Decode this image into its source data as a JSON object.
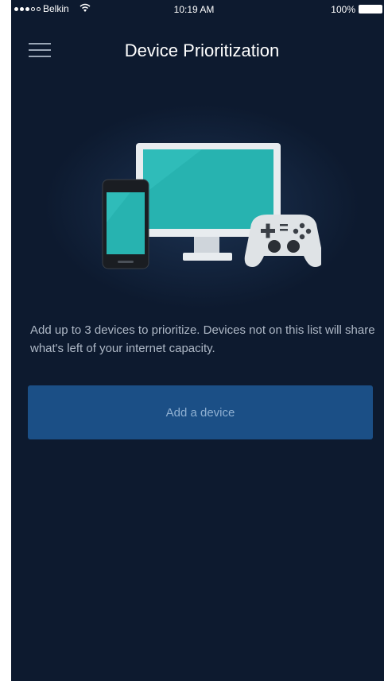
{
  "status_bar": {
    "carrier": "Belkin",
    "time": "10:19 AM",
    "battery": "100%"
  },
  "header": {
    "title": "Device Prioritization"
  },
  "main": {
    "description": "Add up to 3 devices to prioritize. Devices not on this list will share what's left of your internet capacity.",
    "add_button_label": "Add a device"
  },
  "icons": {
    "menu": "hamburger-icon",
    "wifi": "wifi-icon",
    "battery": "battery-icon"
  },
  "colors": {
    "background": "#0d1a2f",
    "button": "#1b4f86",
    "button_text": "#8fb0d2",
    "screen_accent": "#27b3b0"
  }
}
